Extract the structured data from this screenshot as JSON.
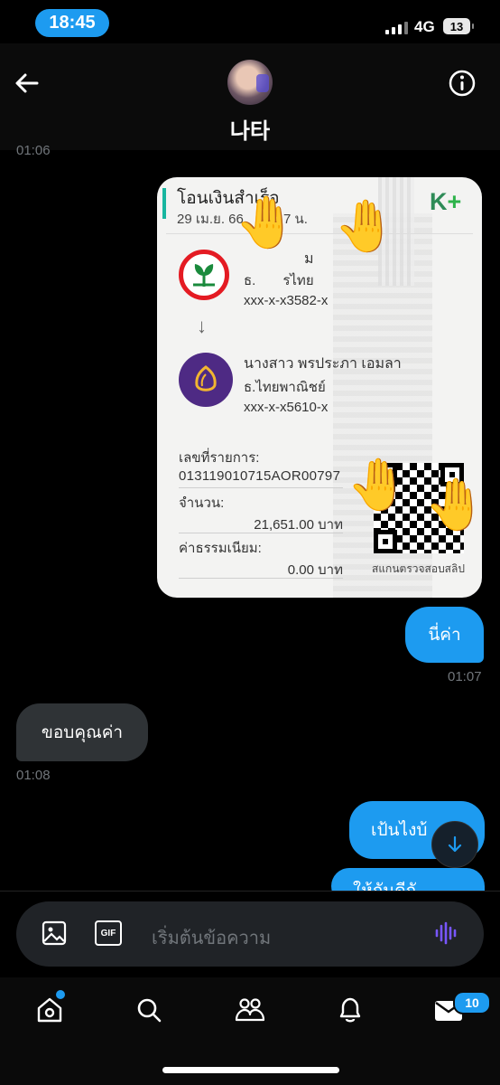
{
  "status_bar": {
    "time": "18:45",
    "network": "4G",
    "battery": "13"
  },
  "header": {
    "contact_name": "나타"
  },
  "messages": {
    "prev_timestamp": "01:06",
    "slip": {
      "title": "โอนเงินสำเร็จ",
      "date": "29 เม.ย. 66 ",
      "date_suffix": "7 น.",
      "brand": "K",
      "brand_plus": "+",
      "sender_name_partial": "ม",
      "sender_bank": "ธ.",
      "sender_bank_suffix": "รไทย",
      "sender_account": "xxx-x-x3582-x",
      "receiver_name": "นางสาว พรประภา เอมลา",
      "receiver_bank": "ธ.ไทยพาณิชย์",
      "receiver_account": "xxx-x-x5610-x",
      "ref_label": "เลขที่รายการ:",
      "ref_value": "013119010715AOR00797",
      "amount_label": "จำนวน:",
      "amount_value": "21,651.00 บาท",
      "fee_label": "ค่าธรรมเนียม:",
      "fee_value": "0.00 บาท",
      "qr_caption": "สแกนตรวจสอบสลิป"
    },
    "emoji_hand": "🤚",
    "out_1": {
      "text": "นี่ค่า",
      "time": "01:07"
    },
    "in_1": {
      "text": "ขอบคุณค่า",
      "time": "01:08"
    },
    "out_2": {
      "text": "เป้นไงบ้"
    },
    "out_3": {
      "text": "ให้กันดีกั"
    }
  },
  "composer": {
    "placeholder": "เริ่มต้นข้อความ",
    "gif_label": "GIF"
  },
  "tabbar": {
    "messages_badge": "10"
  },
  "colors": {
    "accent": "#1d9bf0",
    "incoming_bubble": "#2f3336",
    "background": "#000000"
  }
}
